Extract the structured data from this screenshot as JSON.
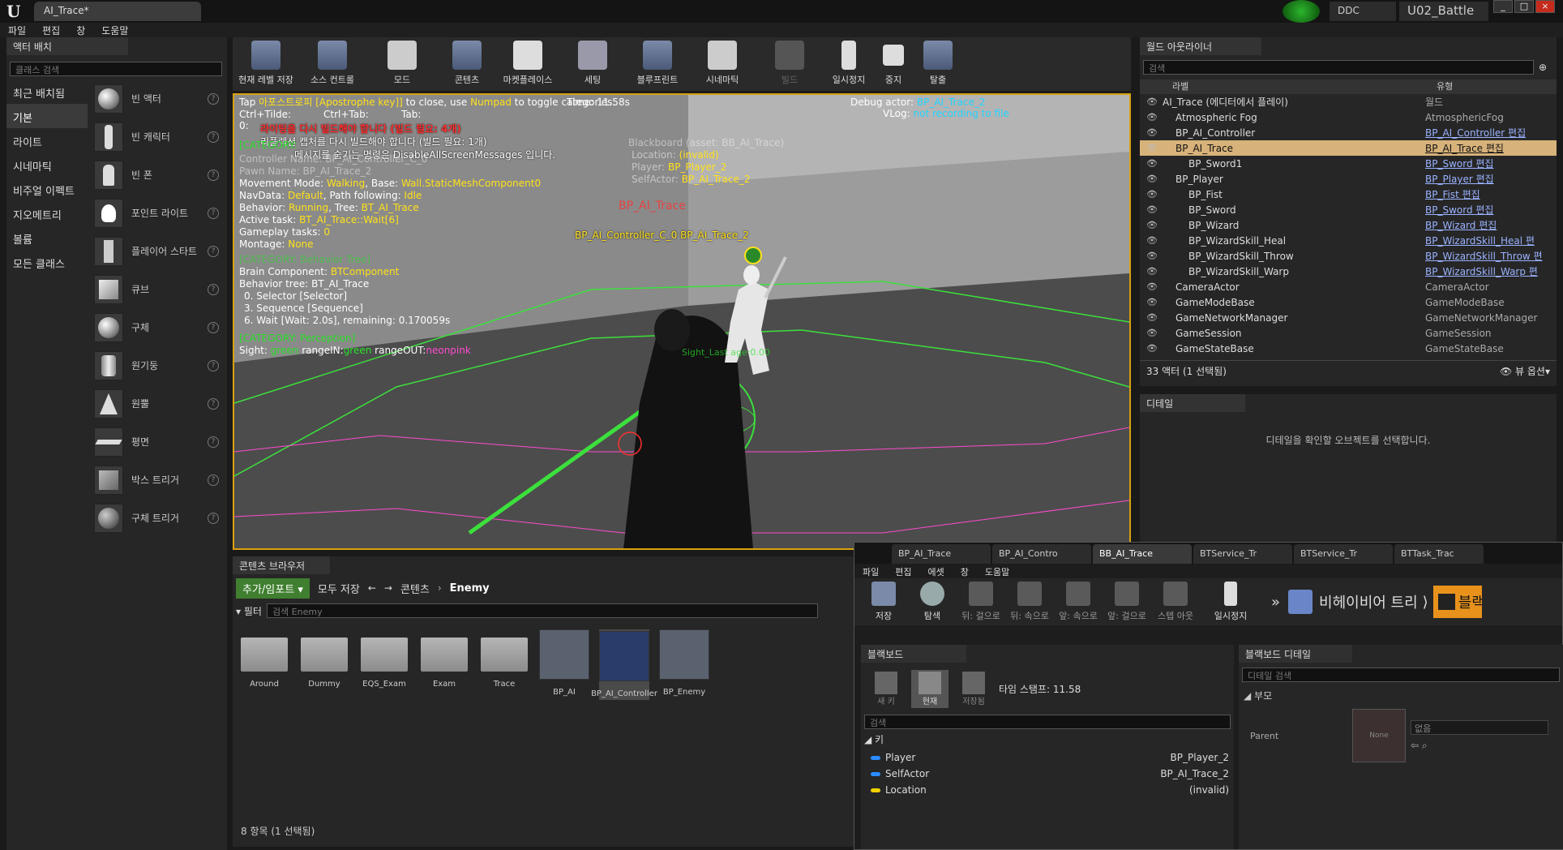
{
  "title_tab": "AI_Trace*",
  "menu": [
    "파일",
    "편집",
    "창",
    "도움말"
  ],
  "topright": {
    "ddc": "DDC",
    "project": "U02_Battle"
  },
  "left": {
    "tab": "액터 배치",
    "search_placeholder": "클래스 검색",
    "categories": [
      "최근 배치됨",
      "기본",
      "라이트",
      "시네마틱",
      "비주얼 이펙트",
      "지오메트리",
      "볼륨",
      "모든 클래스"
    ],
    "actors": [
      "빈 액터",
      "빈 캐릭터",
      "빈 폰",
      "포인트 라이트",
      "플레이어 스타트",
      "큐브",
      "구체",
      "원기둥",
      "원뿔",
      "평면",
      "박스 트리거",
      "구체 트리거"
    ]
  },
  "toolbar": [
    "현재 레벨 저장",
    "소스 컨트롤",
    "모드",
    "콘텐츠",
    "마켓플레이스",
    "세팅",
    "블루프린트",
    "시네마틱",
    "빌드",
    "일시정지",
    "중지",
    "탈출"
  ],
  "viewport": {
    "line1a": "Tap ",
    "line1b": "아포스트로피 [Apostrophe key]]",
    "line1c": " to close, use ",
    "line1d": "Numpad",
    "line1e": " to toggle categories.",
    "time": "Time: 11.58s",
    "debug_actor_label": "Debug actor: ",
    "debug_actor": "BP_AI_Trace_2",
    "vlog_label": "VLog: ",
    "vlog": "not recording to file",
    "ctrl_tilde": "Ctrl+Tilde:",
    "ctrl_tab": "Ctrl+Tab:",
    "tab": "Tab:",
    "warn1": "라이팅을 다시 빌드해야 합니다 (빌드 필요: 4개)",
    "warn2": "리플렉션 캡처를 다시 빌드해야 합니다 (빌드 필요: 1개)",
    "warn3": "메시지를 숨기는 명령은 DisableAllScreenMessages 입니다.",
    "cat_label": "[CATEGORY: ",
    "controller": "Controller Name: BP_AI_Controller_C_0",
    "pawn": "Pawn Name: BP_AI_Trace_2",
    "move_a": "Movement Mode: ",
    "move_b": "Walking",
    "move_c": ", Base: ",
    "move_d": "Wall.StaticMeshComponent0",
    "nav_a": "NavData: ",
    "nav_b": "Default",
    "nav_c": ", Path following: ",
    "nav_d": "Idle",
    "beh_a": "Behavior: ",
    "beh_b": "Running",
    "beh_c": ", Tree: ",
    "beh_d": "BT_AI_Trace",
    "task_a": "Active task: ",
    "task_b": "BT_AI_Trace::Wait[6]",
    "gp_a": "Gameplay tasks: ",
    "gp_b": "0",
    "mont_a": "Montage: ",
    "mont_b": "None",
    "bt_cat": "[CATEGORY: Behavior Tree]",
    "brain_a": "Brain Component: ",
    "brain_b": "BTComponent",
    "btree": "Behavior tree: BT_AI_Trace",
    "n0": "0. Selector [Selector]",
    "n3": "3. Sequence [Sequence]",
    "n6": "6. Wait [Wait: 2.0s], remaining: 0.170059s",
    "perc_cat": "[CATEGORY: Perception]",
    "sight_a": "Sight: ",
    "sight_b": "green",
    "sight_c": " rangeIN:",
    "sight_d": "green",
    "sight_e": " rangeOUT:",
    "sight_f": "neonpink",
    "bb_title": "Blackboard (asset: BB_AI_Trace)",
    "bb_loc_a": "Location: ",
    "bb_loc_b": "(invalid)",
    "bb_player_a": "Player: ",
    "bb_player_b": "BP_Player_2",
    "bb_self_a": "SelfActor: ",
    "bb_self_b": "BP_AI_Trace_2",
    "label_ai": "BP_AI_Trace",
    "label_ctrl": "BP_AI_Controller_C_0 BP_AI_Trace_2",
    "sight_age": "Sight_Last age:0.00"
  },
  "outliner": {
    "tab": "월드 아웃라이너",
    "search_placeholder": "검색",
    "col_label": "라벨",
    "col_type": "유형",
    "rows": [
      {
        "label": "AI_Trace (에디터에서 플레이)",
        "type": "월드",
        "link": false
      },
      {
        "label": "Atmospheric Fog",
        "type": "AtmosphericFog",
        "link": false
      },
      {
        "label": "BP_AI_Controller",
        "type": "BP_AI_Controller 편집",
        "link": true
      },
      {
        "label": "BP_AI_Trace",
        "type": "BP_AI_Trace 편집",
        "link": true
      },
      {
        "label": "BP_Sword1",
        "type": "BP_Sword 편집",
        "link": true
      },
      {
        "label": "BP_Player",
        "type": "BP_Player 편집",
        "link": true
      },
      {
        "label": "BP_Fist",
        "type": "BP_Fist 편집",
        "link": true
      },
      {
        "label": "BP_Sword",
        "type": "BP_Sword 편집",
        "link": true
      },
      {
        "label": "BP_Wizard",
        "type": "BP_Wizard 편집",
        "link": true
      },
      {
        "label": "BP_WizardSkill_Heal",
        "type": "BP_WizardSkill_Heal 편",
        "link": true
      },
      {
        "label": "BP_WizardSkill_Throw",
        "type": "BP_WizardSkill_Throw 편",
        "link": true
      },
      {
        "label": "BP_WizardSkill_Warp",
        "type": "BP_WizardSkill_Warp 편",
        "link": true
      },
      {
        "label": "CameraActor",
        "type": "CameraActor",
        "link": false
      },
      {
        "label": "GameModeBase",
        "type": "GameModeBase",
        "link": false
      },
      {
        "label": "GameNetworkManager",
        "type": "GameNetworkManager",
        "link": false
      },
      {
        "label": "GameSession",
        "type": "GameSession",
        "link": false
      },
      {
        "label": "GameStateBase",
        "type": "GameStateBase",
        "link": false
      }
    ],
    "footer": "33 액터 (1 선택됨)",
    "view_options": "뷰 옵션"
  },
  "details": {
    "tab": "디테일",
    "empty": "디테일을 확인할 오브젝트를 선택합니다."
  },
  "content_browser": {
    "tab": "콘텐츠 브라우저",
    "add_import": "추가/임포트",
    "save_all": "모두 저장",
    "path_root": "콘텐츠",
    "path_sub": "Enemy",
    "filter": "필터",
    "search_placeholder": "검색 Enemy",
    "folders": [
      "Around",
      "Dummy",
      "EQS_Exam",
      "Exam",
      "Trace"
    ],
    "assets": [
      "BP_AI",
      "BP_AI_Controller",
      "BP_Enemy"
    ],
    "status": "8 항목 (1 선택됨)"
  },
  "bt_window": {
    "tabs": [
      "BP_AI_Trace",
      "BP_AI_Contro",
      "BB_AI_Trace",
      "BTService_Tr",
      "BTService_Tr",
      "BTTask_Trac"
    ],
    "menu": [
      "파일",
      "편집",
      "에셋",
      "창",
      "도움말"
    ],
    "tools": [
      "저장",
      "탐색",
      "뒤: 걸으로",
      "뒤: 속으로",
      "앞: 속으로",
      "앞: 걸으로",
      "스텝 아웃",
      "일시정지"
    ],
    "bt_label": "비헤이비어 트리",
    "bb_label": "블랙",
    "blackboard_tab": "블랙보드",
    "bb_details_tab": "블랙보드 디테일",
    "new_key": "새 키",
    "current": "현재",
    "saved": "저장됨",
    "timestamp": "타임 스탬프: 11.58",
    "search_placeholder": "검색",
    "keys_header": "키",
    "keys": [
      {
        "name": "Player",
        "value": "BP_Player_2",
        "color": "#2a8cff"
      },
      {
        "name": "SelfActor",
        "value": "BP_AI_Trace_2",
        "color": "#2a8cff"
      },
      {
        "name": "Location",
        "value": "(invalid)",
        "color": "#f0d000"
      }
    ],
    "details_search": "디테일 검색",
    "parent_section": "부모",
    "parent_label": "Parent",
    "none_thumb": "None",
    "none_value": "없음"
  }
}
